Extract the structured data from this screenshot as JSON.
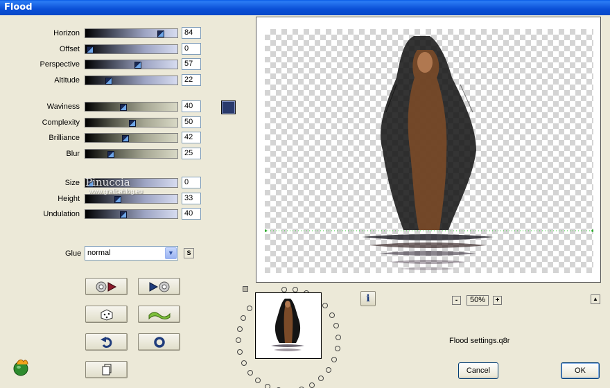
{
  "window": {
    "title": "Flood"
  },
  "sliders_group1": [
    {
      "key": "horizon",
      "label": "Horizon",
      "value": "84",
      "fraction": 0.84,
      "style": "blue"
    },
    {
      "key": "offset",
      "label": "Offset",
      "value": "0",
      "fraction": 0.0,
      "style": "blue"
    },
    {
      "key": "perspective",
      "label": "Perspective",
      "value": "57",
      "fraction": 0.57,
      "style": "blue"
    },
    {
      "key": "altitude",
      "label": "Altitude",
      "value": "22",
      "fraction": 0.22,
      "style": "blue"
    }
  ],
  "sliders_group2": [
    {
      "key": "waviness",
      "label": "Waviness",
      "value": "40",
      "fraction": 0.4,
      "style": "khaki"
    },
    {
      "key": "complexity",
      "label": "Complexity",
      "value": "50",
      "fraction": 0.5,
      "style": "khaki"
    },
    {
      "key": "brilliance",
      "label": "Brilliance",
      "value": "42",
      "fraction": 0.42,
      "style": "khaki"
    },
    {
      "key": "blur",
      "label": "Blur",
      "value": "25",
      "fraction": 0.25,
      "style": "khaki"
    }
  ],
  "sliders_group3": [
    {
      "key": "size",
      "label": "Size",
      "value": "0",
      "fraction": 0.0,
      "style": "blue"
    },
    {
      "key": "height",
      "label": "Height",
      "value": "33",
      "fraction": 0.33,
      "style": "blue"
    },
    {
      "key": "undulation",
      "label": "Undulation",
      "value": "40",
      "fraction": 0.4,
      "style": "blue"
    }
  ],
  "flood_color": "#2a3a6c",
  "glue": {
    "label": "Glue",
    "selected": "normal",
    "s_button": "S"
  },
  "watermark": {
    "name": "Pinuccia",
    "url": "www.graficablog.eu"
  },
  "preview_zoom": {
    "minus": "-",
    "value": "50%",
    "plus": "+"
  },
  "settings_file": "Flood settings.q8r",
  "buttons": {
    "cancel": "Cancel",
    "ok": "OK"
  },
  "icons": [
    "load-preset-icon",
    "save-preset-icon",
    "randomize-icon",
    "wave-icon",
    "undo-icon",
    "reset-icon",
    "copy-icon",
    "info-icon",
    "app-logo-icon"
  ]
}
